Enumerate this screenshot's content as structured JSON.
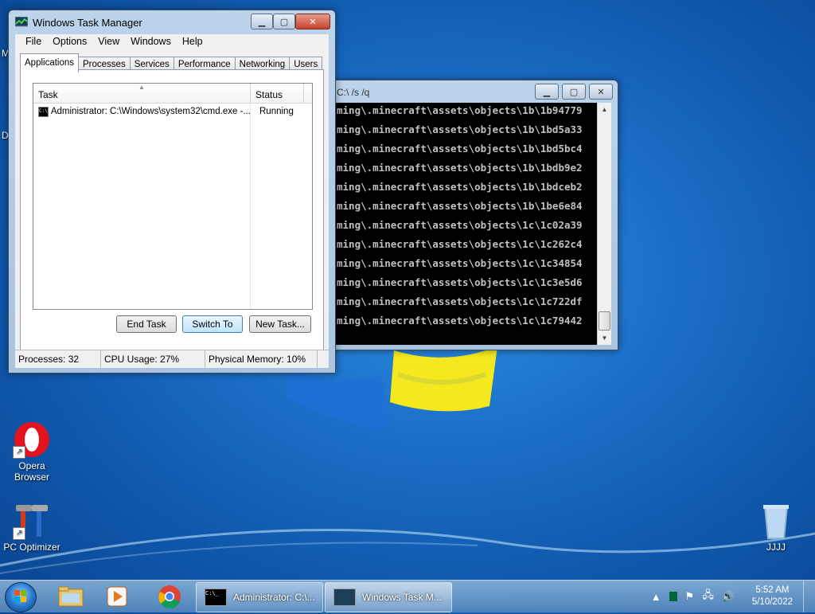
{
  "desktop": {
    "icons": [
      {
        "label": "Opera Browser"
      },
      {
        "label": "PC Optimizer"
      },
      {
        "label": "JJJJ"
      }
    ],
    "edge_letters": [
      "M",
      "D"
    ]
  },
  "task_manager": {
    "title": "Windows Task Manager",
    "menu": [
      "File",
      "Options",
      "View",
      "Windows",
      "Help"
    ],
    "tabs": [
      "Applications",
      "Processes",
      "Services",
      "Performance",
      "Networking",
      "Users"
    ],
    "active_tab": "Applications",
    "columns": {
      "task": "Task",
      "status": "Status"
    },
    "rows": [
      {
        "task": "Administrator: C:\\Windows\\system32\\cmd.exe -...",
        "status": "Running"
      }
    ],
    "buttons": {
      "end_task": "End Task",
      "switch_to": "Switch To",
      "new_task": "New Task..."
    },
    "status": {
      "processes": "Processes: 32",
      "cpu": "CPU Usage: 27%",
      "memory": "Physical Memory: 10%"
    }
  },
  "cmd_window": {
    "title": "C:\\ /s /q",
    "lines": [
      "ming\\.minecraft\\assets\\objects\\1b\\1b94779",
      "ming\\.minecraft\\assets\\objects\\1b\\1bd5a33",
      "ming\\.minecraft\\assets\\objects\\1b\\1bd5bc4",
      "ming\\.minecraft\\assets\\objects\\1b\\1bdb9e2",
      "ming\\.minecraft\\assets\\objects\\1b\\1bdceb2",
      "ming\\.minecraft\\assets\\objects\\1b\\1be6e84",
      "ming\\.minecraft\\assets\\objects\\1c\\1c02a39",
      "ming\\.minecraft\\assets\\objects\\1c\\1c262c4",
      "ming\\.minecraft\\assets\\objects\\1c\\1c34854",
      "ming\\.minecraft\\assets\\objects\\1c\\1c3e5d6",
      "ming\\.minecraft\\assets\\objects\\1c\\1c722df",
      "ming\\.minecraft\\assets\\objects\\1c\\1c79442"
    ]
  },
  "taskbar": {
    "tasks": [
      {
        "label": "Administrator: C:\\..."
      },
      {
        "label": "Windows Task M..."
      }
    ],
    "clock_time": "5:52 AM",
    "clock_date": "5/10/2022"
  },
  "colors": {
    "accent": "#1b6fc8",
    "console_bg": "#000000",
    "console_text": "#c0c0c0"
  }
}
